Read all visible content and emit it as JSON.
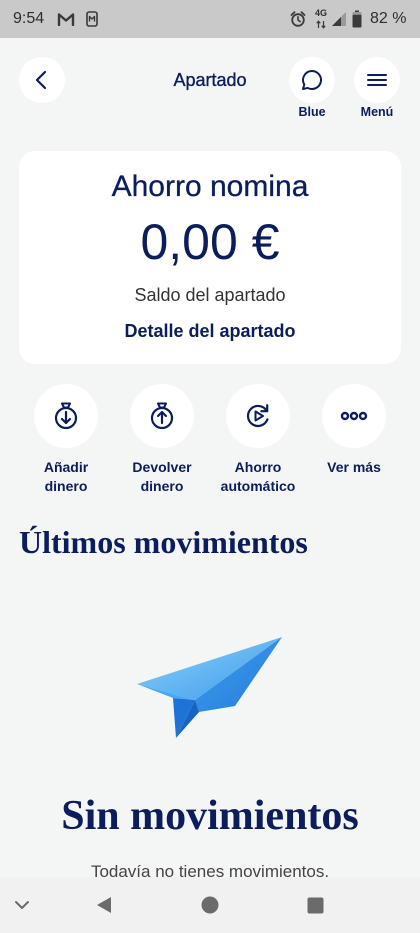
{
  "status_bar": {
    "time": "9:54",
    "network": "4G",
    "battery": "82 %",
    "notification_icons": [
      "gmail-icon",
      "app-notification-icon"
    ],
    "system_icons": [
      "alarm-icon",
      "network-arrows-icon",
      "signal-icon",
      "battery-icon"
    ]
  },
  "header": {
    "title": "Apartado",
    "back": {
      "icon": "chevron-left-icon"
    },
    "chat": {
      "label": "Blue",
      "icon": "chat-bubble-icon"
    },
    "menu": {
      "label": "Menú",
      "icon": "hamburger-menu-icon"
    }
  },
  "savings_card": {
    "name": "Ahorro nomina",
    "balance": "0,00 €",
    "balance_label": "Saldo del apartado",
    "detail_link": "Detalle del apartado"
  },
  "actions": [
    {
      "label": "Añadir dinero",
      "icon": "add-money-icon"
    },
    {
      "label": "Devolver dinero",
      "icon": "return-money-icon"
    },
    {
      "label": "Ahorro automático",
      "icon": "auto-saving-icon"
    },
    {
      "label": "Ver más",
      "icon": "more-dots-icon"
    }
  ],
  "movements": {
    "heading": "Últimos movimientos",
    "illustration": "paper-plane-illustration",
    "empty_title": "Sin movimientos",
    "empty_text": "Todavía no tienes movimientos."
  },
  "nav_bar": {
    "icons": [
      "chevron-down-icon",
      "back-icon",
      "home-icon",
      "recents-icon"
    ]
  },
  "colors": {
    "primary": "#0c1d5c",
    "background": "#f4f5f5",
    "card": "#ffffff",
    "status_bar": "#c9c9c9",
    "nav_bar": "#f1f1f1",
    "plane": "#3b9bea"
  }
}
